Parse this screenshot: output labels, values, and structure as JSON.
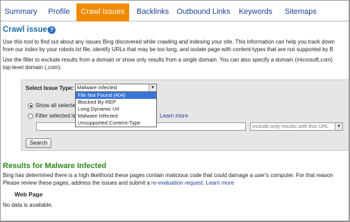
{
  "tabs": [
    {
      "label": "Summary"
    },
    {
      "label": "Profile"
    },
    {
      "label": "Crawl Issues"
    },
    {
      "label": "Backlinks"
    },
    {
      "label": "Outbound Links"
    },
    {
      "label": "Keywords"
    },
    {
      "label": "Sitemaps"
    }
  ],
  "active_tab": "Crawl Issues",
  "colors": {
    "active_tab": "#f08a00",
    "link": "#1a3f96",
    "results_heading": "#2e8a18",
    "section_heading": "#1e6ea8"
  },
  "crawl": {
    "title": "Crawl issues",
    "help_icon": "?",
    "para1_line1": "Use this tool to find out about any issues Bing discovered while crawling and indexing your site. This information can help you track down",
    "para1_line2": "from our index by your robots.txt file, identify URLs that may be too long, and isolate page with content-types that are not supported by B",
    "para2_line1": "Use the filter to exclude results from a domain or show only results from a single domain. You can also specify a domain (microsoft.com)",
    "para2_line2": "top-level domain (.com)."
  },
  "filter": {
    "issue_type_label": "Select Issue Type:",
    "selected_issue": "Malware Infected",
    "options": [
      "File Not Found (404)",
      "Blocked By REP",
      "Long Dynamic Url",
      "Malware Infected",
      "Unsupported Content-Type"
    ],
    "highlighted_option": "File Not Found (404)",
    "show_all_label": "Show all selecte",
    "filter_label": "Filter selected is",
    "learn_more": "Learn more",
    "domain_value": "",
    "include_mode": "Include only results with this URL",
    "search_button": "Search"
  },
  "results": {
    "title": "Results for Malware Infected",
    "line1": "Bing has determined there is a high likelihood these pages contain malicious code that could damage a user's computer. For that reason",
    "line2_prefix": "Please review these pages, address the issues and submit a ",
    "reeval_link": "re-evaluation request",
    "line2_suffix": ".  ",
    "learn_more": "Learn more",
    "column_header": "Web Page",
    "empty_message": "No data is available."
  }
}
